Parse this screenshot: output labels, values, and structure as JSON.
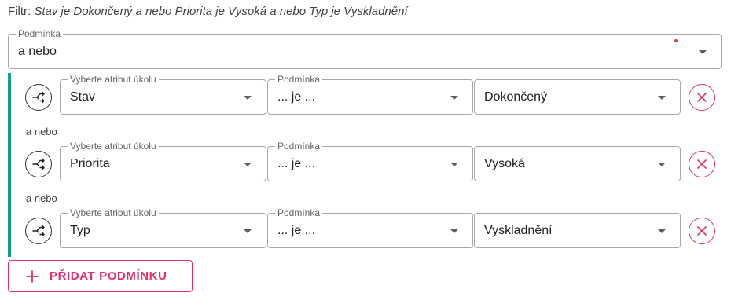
{
  "filter": {
    "prefix": "Filtr:",
    "expression": "Stav je Dokončený a nebo Priorita je Vysoká a nebo Typ je Vyskladnění"
  },
  "operator": {
    "legend": "Podmínka",
    "value": "a nebo"
  },
  "conditions": [
    {
      "attribute_legend": "Vyberte atribut úkolu",
      "attribute": "Stav",
      "operator_legend": "Podmínka",
      "operator": "... je ...",
      "value": "Dokončený"
    },
    {
      "attribute_legend": "Vyberte atribut úkolu",
      "attribute": "Priorita",
      "operator_legend": "Podmínka",
      "operator": "... je ...",
      "value": "Vysoká"
    },
    {
      "attribute_legend": "Vyberte atribut úkolu",
      "attribute": "Typ",
      "operator_legend": "Podmínka",
      "operator": "... je ...",
      "value": "Vyskladnění"
    }
  ],
  "conjunctions": [
    "a nebo",
    "a nebo"
  ],
  "add_button": {
    "label": "PŘIDAT PODMÍNKU"
  },
  "icons": {
    "swap": "swap-icon",
    "remove": "close-icon",
    "add": "plus-icon",
    "dropdown": "chevron-down-icon"
  },
  "colors": {
    "accent": "#e0316b",
    "group_bar": "#14a085",
    "required_dot": "#e53935"
  }
}
